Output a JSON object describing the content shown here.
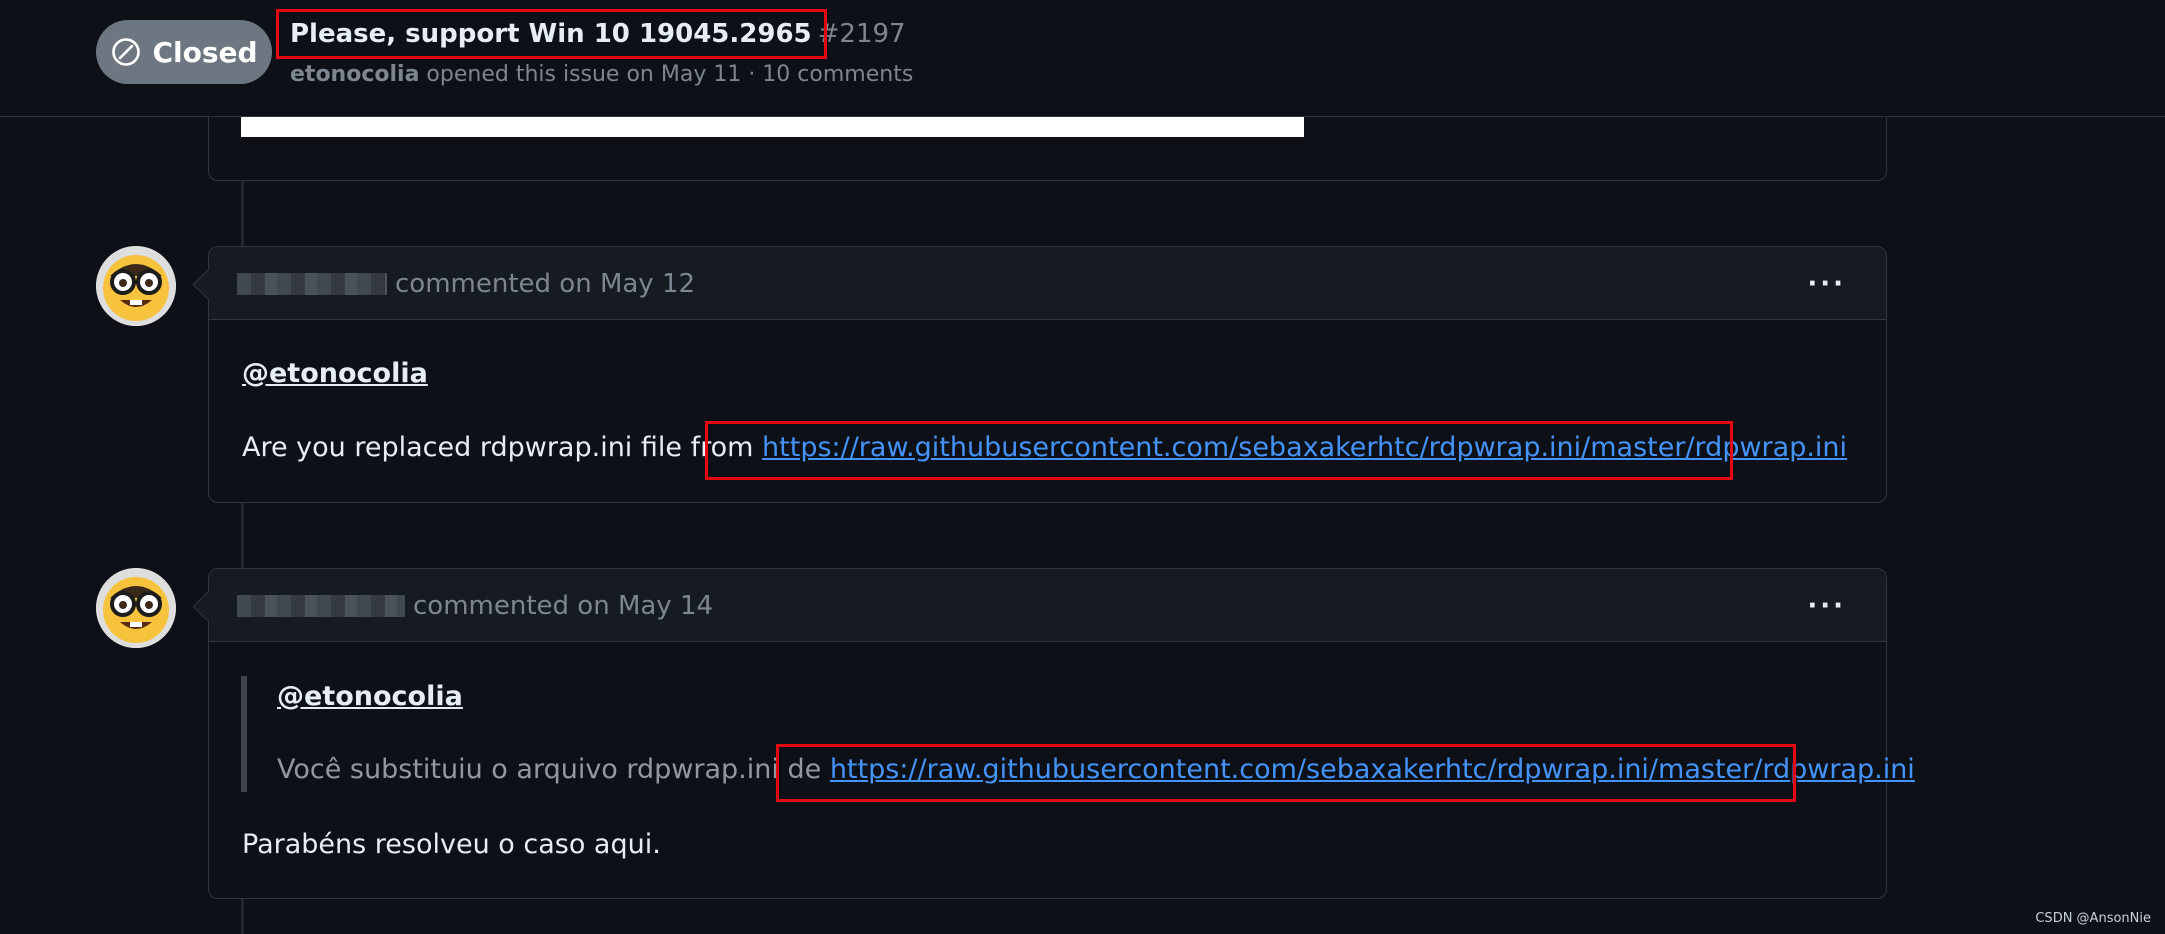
{
  "header": {
    "state_label": "Closed",
    "title": "Please, support Win 10 19045.2965",
    "number": "#2197",
    "author": "etonocolia",
    "meta_rest": "opened this issue on May 11 · 10 comments"
  },
  "comments": [
    {
      "action": "commented on May 12",
      "mention": "@etonocolia",
      "text_before_link": "Are you replaced rdpwrap.ini file from",
      "link": "https://raw.githubusercontent.com/sebaxakerhtc/rdpwrap.ini/master/rdpwrap.ini"
    },
    {
      "action": "commented on May 14",
      "quote_mention": "@etonocolia",
      "quote_text_before_link": "Você substituiu o arquivo rdpwrap.ini de",
      "quote_link": "https://raw.githubusercontent.com/sebaxakerhtc/rdpwrap.ini/master/rdpwrap.ini",
      "reply": "Parabéns resolveu o caso aqui."
    }
  ],
  "kebab_label": "···",
  "watermark": "CSDN @AnsonNie",
  "colors": {
    "background": "#0d1117",
    "badge_closed": "#6e7681",
    "link": "#4493f8",
    "highlight": "#e50914"
  },
  "icons": {
    "state": "circle-slash-icon",
    "kebab": "kebab-horizontal-icon",
    "avatar": "nerd-face-emoji"
  }
}
